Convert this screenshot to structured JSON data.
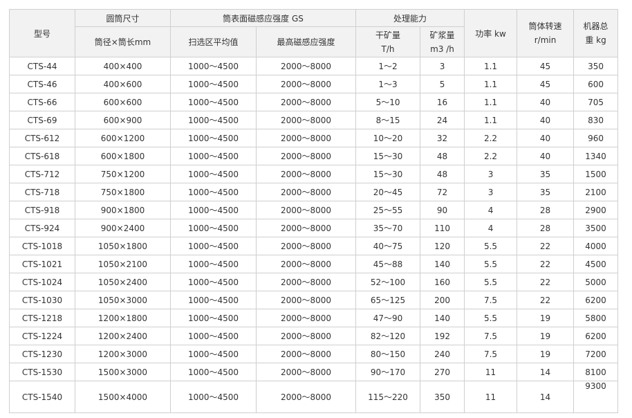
{
  "header": {
    "model": "型号",
    "drum_size": "圆筒尺寸",
    "drum_size_sub": "筒径×筒长mm",
    "field_strength": "筒表面磁感应强度 GS",
    "field_avg": "扫选区平均值",
    "field_max": "最高磁感应强度",
    "capacity": "处理能力",
    "dry_ore_1": "干矿量",
    "dry_ore_2": "T/h",
    "slurry_1": "矿浆量",
    "slurry_2": "m3 /h",
    "power": "功率 kw",
    "speed_1": "筒体转速",
    "speed_2": "r/min",
    "weight_1": "机器总",
    "weight_2": "重 kg"
  },
  "rows": [
    {
      "model": "CTS-44",
      "size": "400×400",
      "avg": "1000～4500",
      "max": "2000～8000",
      "dry": "1～2",
      "slurry": "3",
      "power": "1.1",
      "speed": "45",
      "weight": "350"
    },
    {
      "model": "CTS-46",
      "size": "400×600",
      "avg": "1000～4500",
      "max": "2000～8000",
      "dry": "1～3",
      "slurry": "5",
      "power": "1.1",
      "speed": "45",
      "weight": "600"
    },
    {
      "model": "CTS-66",
      "size": "600×600",
      "avg": "1000～4500",
      "max": "2000～8000",
      "dry": "5～10",
      "slurry": "16",
      "power": "1.1",
      "speed": "40",
      "weight": "705"
    },
    {
      "model": "CTS-69",
      "size": "600×900",
      "avg": "1000～4500",
      "max": "2000～8000",
      "dry": "8～15",
      "slurry": "24",
      "power": "1.1",
      "speed": "40",
      "weight": "830"
    },
    {
      "model": "CTS-612",
      "size": "600×1200",
      "avg": "1000～4500",
      "max": "2000～8000",
      "dry": "10～20",
      "slurry": "32",
      "power": "2.2",
      "speed": "40",
      "weight": "960"
    },
    {
      "model": "CTS-618",
      "size": "600×1800",
      "avg": "1000～4500",
      "max": "2000～8000",
      "dry": "15～30",
      "slurry": "48",
      "power": "2.2",
      "speed": "40",
      "weight": "1340"
    },
    {
      "model": "CTS-712",
      "size": "750×1200",
      "avg": "1000～4500",
      "max": "2000～8000",
      "dry": "15～30",
      "slurry": "48",
      "power": "3",
      "speed": "35",
      "weight": "1500"
    },
    {
      "model": "CTS-718",
      "size": "750×1800",
      "avg": "1000～4500",
      "max": "2000～8000",
      "dry": "20～45",
      "slurry": "72",
      "power": "3",
      "speed": "35",
      "weight": "2100"
    },
    {
      "model": "CTS-918",
      "size": "900×1800",
      "avg": "1000～4500",
      "max": "2000～8000",
      "dry": "25～55",
      "slurry": "90",
      "power": "4",
      "speed": "28",
      "weight": "2900"
    },
    {
      "model": "CTS-924",
      "size": "900×2400",
      "avg": "1000～4500",
      "max": "2000～8000",
      "dry": "35～70",
      "slurry": "110",
      "power": "4",
      "speed": "28",
      "weight": "3500"
    },
    {
      "model": "CTS-1018",
      "size": "1050×1800",
      "avg": "1000～4500",
      "max": "2000～8000",
      "dry": "40～75",
      "slurry": "120",
      "power": "5.5",
      "speed": "22",
      "weight": "4000"
    },
    {
      "model": "CTS-1021",
      "size": "1050×2100",
      "avg": "1000～4500",
      "max": "2000～8000",
      "dry": "45～88",
      "slurry": "140",
      "power": "5.5",
      "speed": "22",
      "weight": "4500"
    },
    {
      "model": "CTS-1024",
      "size": "1050×2400",
      "avg": "1000～4500",
      "max": "2000～8000",
      "dry": "52～100",
      "slurry": "160",
      "power": "5.5",
      "speed": "22",
      "weight": "5000"
    },
    {
      "model": "CTS-1030",
      "size": "1050×3000",
      "avg": "1000～4500",
      "max": "2000～8000",
      "dry": "65～125",
      "slurry": "200",
      "power": "7.5",
      "speed": "22",
      "weight": "6200"
    },
    {
      "model": "CTS-1218",
      "size": "1200×1800",
      "avg": "1000～4500",
      "max": "2000～8000",
      "dry": "47～90",
      "slurry": "140",
      "power": "5.5",
      "speed": "19",
      "weight": "5800"
    },
    {
      "model": "CTS-1224",
      "size": "1200×2400",
      "avg": "1000～4500",
      "max": "2000～8000",
      "dry": "82～120",
      "slurry": "192",
      "power": "7.5",
      "speed": "19",
      "weight": "6200"
    },
    {
      "model": "CTS-1230",
      "size": "1200×3000",
      "avg": "1000～4500",
      "max": "2000～8000",
      "dry": "80～150",
      "slurry": "240",
      "power": "7.5",
      "speed": "19",
      "weight": "7200"
    },
    {
      "model": "CTS-1530",
      "size": "1500×3000",
      "avg": "1000～4500",
      "max": "2000～8000",
      "dry": "90～170",
      "slurry": "270",
      "power": "11",
      "speed": "14",
      "weight": "8100"
    },
    {
      "model": "CTS-1540",
      "size": "1500×4000",
      "avg": "1000～4500",
      "max": "2000～8000",
      "dry": "115～220",
      "slurry": "350",
      "power": "11",
      "speed": "14",
      "weight": "9300"
    }
  ]
}
